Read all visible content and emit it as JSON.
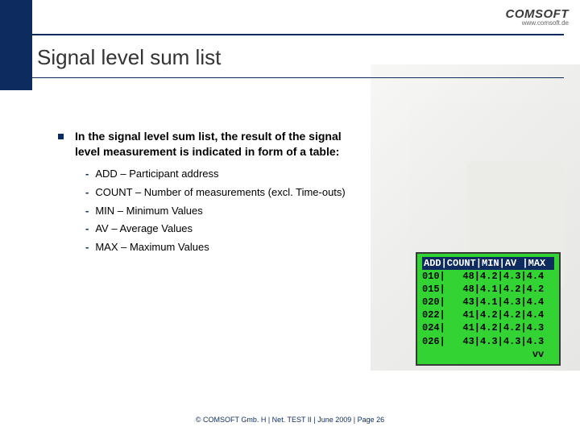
{
  "brand": {
    "name": "COMSOFT",
    "url": "www.comsoft.de"
  },
  "title": "Signal level sum list",
  "intro": "In the signal level sum list, the result of the signal level measurement is indicated in form of a table:",
  "items": [
    "ADD – Participant address",
    "COUNT – Number of measurements (excl. Time-outs)",
    "MIN – Minimum Values",
    "AV – Average Values",
    "MAX – Maximum Values"
  ],
  "screen": {
    "header": "ADD|COUNT|MIN|AV |MAX",
    "rows": [
      "010|   48|4.2|4.3|4.4",
      "015|   48|4.1|4.2|4.2",
      "020|   43|4.1|4.3|4.4",
      "022|   41|4.2|4.2|4.4",
      "024|   41|4.2|4.2|4.3",
      "026|   43|4.3|4.3|4.3",
      "                   vv"
    ]
  },
  "footer": "© COMSOFT Gmb. H | Net. TEST II | June 2009 | Page 26"
}
